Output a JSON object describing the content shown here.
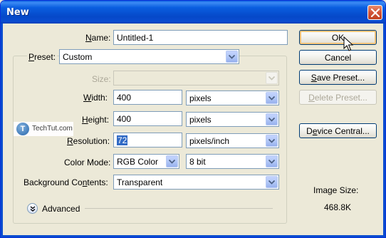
{
  "window": {
    "title": "New"
  },
  "form": {
    "name": {
      "label": "Name:",
      "label_mnemonic": "N",
      "label_rest": "ame:",
      "value": "Untitled-1"
    },
    "preset": {
      "label_mnemonic": "P",
      "label_rest": "reset:",
      "value": "Custom"
    },
    "size": {
      "label": "Size:",
      "value": ""
    },
    "width": {
      "label_mnemonic": "W",
      "label_rest": "idth:",
      "value": "400",
      "unit": "pixels"
    },
    "height": {
      "label_mnemonic": "H",
      "label_rest": "eight:",
      "value": "400",
      "unit": "pixels"
    },
    "resolution": {
      "label_mnemonic": "R",
      "label_rest": "esolution:",
      "value": "72",
      "unit": "pixels/inch"
    },
    "color_mode": {
      "label": "Color Mode:",
      "value": "RGB Color",
      "bit_depth": "8 bit"
    },
    "background": {
      "label_pre": "Background Co",
      "label_mnemonic": "n",
      "label_post": "tents:",
      "value": "Transparent"
    },
    "advanced": {
      "label": "Advanced"
    }
  },
  "buttons": {
    "ok": "OK",
    "cancel": "Cancel",
    "save_preset_mnemonic": "S",
    "save_preset_rest": "ave Preset...",
    "delete_preset_mnemonic": "D",
    "delete_preset_rest": "elete Preset...",
    "device_central_pre": "D",
    "device_central_mnemonic": "e",
    "device_central_post": "vice Central..."
  },
  "image_size": {
    "label": "Image Size:",
    "value": "468.8K"
  },
  "watermark": {
    "letter": "T",
    "text": "TechTut.com"
  },
  "colors": {
    "titlebar": "#0a5ee0",
    "dialog_bg": "#ece9d8",
    "selection": "#316ac5"
  },
  "icons": [
    "close-icon",
    "dropdown-arrow-icon",
    "expand-chevron-icon",
    "mouse-cursor-icon"
  ]
}
